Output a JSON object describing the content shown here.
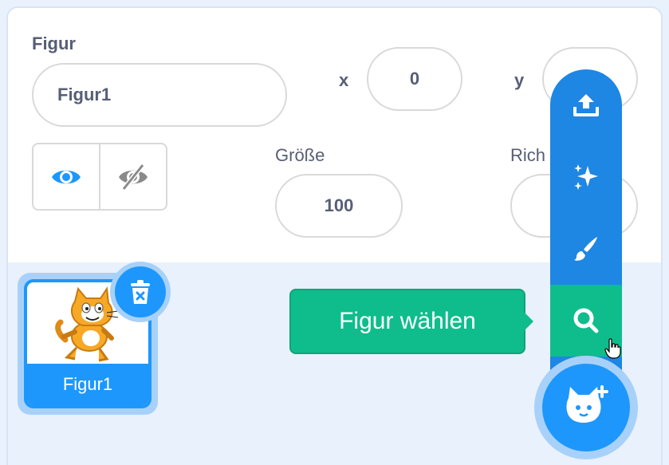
{
  "sprite_info": {
    "sprite_label": "Figur",
    "sprite_name_value": "Figur1",
    "x_label": "x",
    "x_value": "0",
    "y_label": "y",
    "size_label": "Größe",
    "size_value": "100",
    "direction_label_partial": "Rich"
  },
  "sprite_list": {
    "items": [
      {
        "name": "Figur1",
        "selected": true
      }
    ]
  },
  "tooltip": {
    "text": "Figur wählen"
  },
  "add_sprite_menu": {
    "items": [
      {
        "icon": "upload-icon"
      },
      {
        "icon": "sparkle-icon"
      },
      {
        "icon": "paintbrush-icon"
      },
      {
        "icon": "search-icon",
        "active": true
      }
    ],
    "main_button_icon": "cat-add-icon"
  },
  "colors": {
    "accent_blue": "#1d97fc",
    "menu_blue": "#1e86e3",
    "accent_green": "#0fbd8c",
    "text_gray": "#575e75"
  }
}
